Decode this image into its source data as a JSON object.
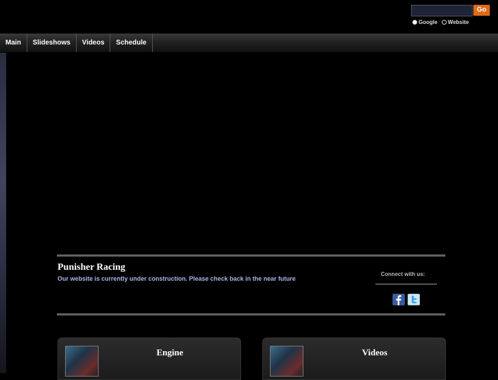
{
  "search": {
    "placeholder": "",
    "go_label": "Go",
    "options": [
      "Google",
      "Website"
    ],
    "selected": "Google"
  },
  "nav": {
    "items": [
      "Main",
      "Slideshows",
      "Videos",
      "Schedule"
    ]
  },
  "site": {
    "title": "Punisher Racing",
    "subtitle": "Our website is currently under construction. Please check back in the near future"
  },
  "connect": {
    "label": "Connect with us:"
  },
  "panels": [
    {
      "title": "Engine"
    },
    {
      "title": "Videos"
    }
  ],
  "colors": {
    "accent": "#e06a18",
    "subtitle": "#aab6e8",
    "facebook": "#3b5ba0"
  }
}
